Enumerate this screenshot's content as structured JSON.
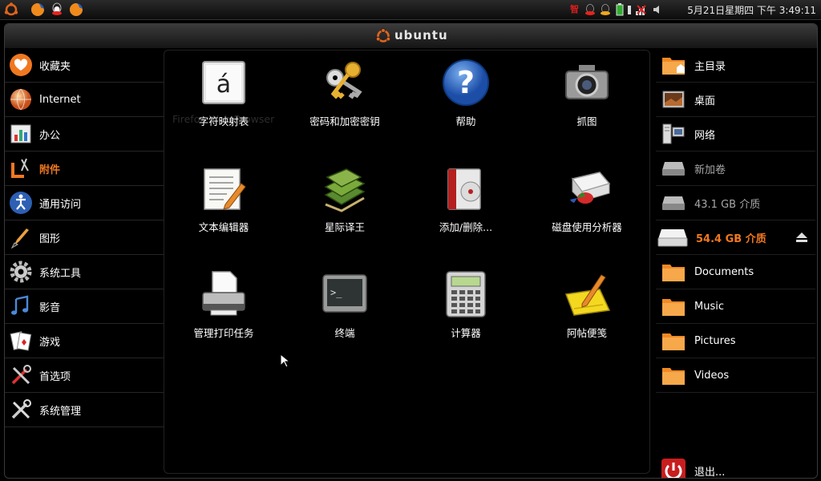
{
  "panel": {
    "clock": "5月21日星期四 下午 3:49:11",
    "tray_text": "智"
  },
  "window": {
    "title": "ubuntu"
  },
  "categories": [
    {
      "label": "收藏夹"
    },
    {
      "label": "Internet"
    },
    {
      "label": "办公"
    },
    {
      "label": "附件",
      "active": true
    },
    {
      "label": "通用访问"
    },
    {
      "label": "图形"
    },
    {
      "label": "系统工具"
    },
    {
      "label": "影音"
    },
    {
      "label": "游戏"
    },
    {
      "label": "首选项"
    },
    {
      "label": "系统管理"
    }
  ],
  "apps": [
    {
      "label": "字符映射表",
      "icon": "char-map-icon"
    },
    {
      "label": "密码和加密密钥",
      "icon": "keys-icon"
    },
    {
      "label": "帮助",
      "icon": "help-icon"
    },
    {
      "label": "抓图",
      "icon": "camera-icon"
    },
    {
      "label": "文本编辑器",
      "icon": "text-editor-icon"
    },
    {
      "label": "星际译王",
      "icon": "dictionary-icon"
    },
    {
      "label": "添加/删除...",
      "icon": "add-remove-icon"
    },
    {
      "label": "磁盘使用分析器",
      "icon": "disk-analyzer-icon"
    },
    {
      "label": "管理打印任务",
      "icon": "printer-icon"
    },
    {
      "label": "终端",
      "icon": "terminal-icon"
    },
    {
      "label": "计算器",
      "icon": "calculator-icon"
    },
    {
      "label": "阿帖便笺",
      "icon": "sticky-notes-icon"
    }
  ],
  "ghost_text": "Firefox Web Browser",
  "places": [
    {
      "label": "主目录",
      "icon": "home-folder-icon"
    },
    {
      "label": "桌面",
      "icon": "desktop-icon"
    },
    {
      "label": "网络",
      "icon": "network-icon"
    },
    {
      "label": "新加卷",
      "icon": "drive-icon",
      "state": "dim"
    },
    {
      "label": "43.1 GB 介质",
      "icon": "drive-icon",
      "state": "dim"
    },
    {
      "label": "54.4 GB 介质",
      "icon": "drive-icon",
      "state": "mounted"
    },
    {
      "label": "Documents",
      "icon": "folder-icon"
    },
    {
      "label": "Music",
      "icon": "folder-icon"
    },
    {
      "label": "Pictures",
      "icon": "folder-icon"
    },
    {
      "label": "Videos",
      "icon": "folder-icon"
    }
  ],
  "logout": {
    "label": "退出..."
  },
  "colors": {
    "accent": "#f07820",
    "folder": "#f08a24"
  }
}
